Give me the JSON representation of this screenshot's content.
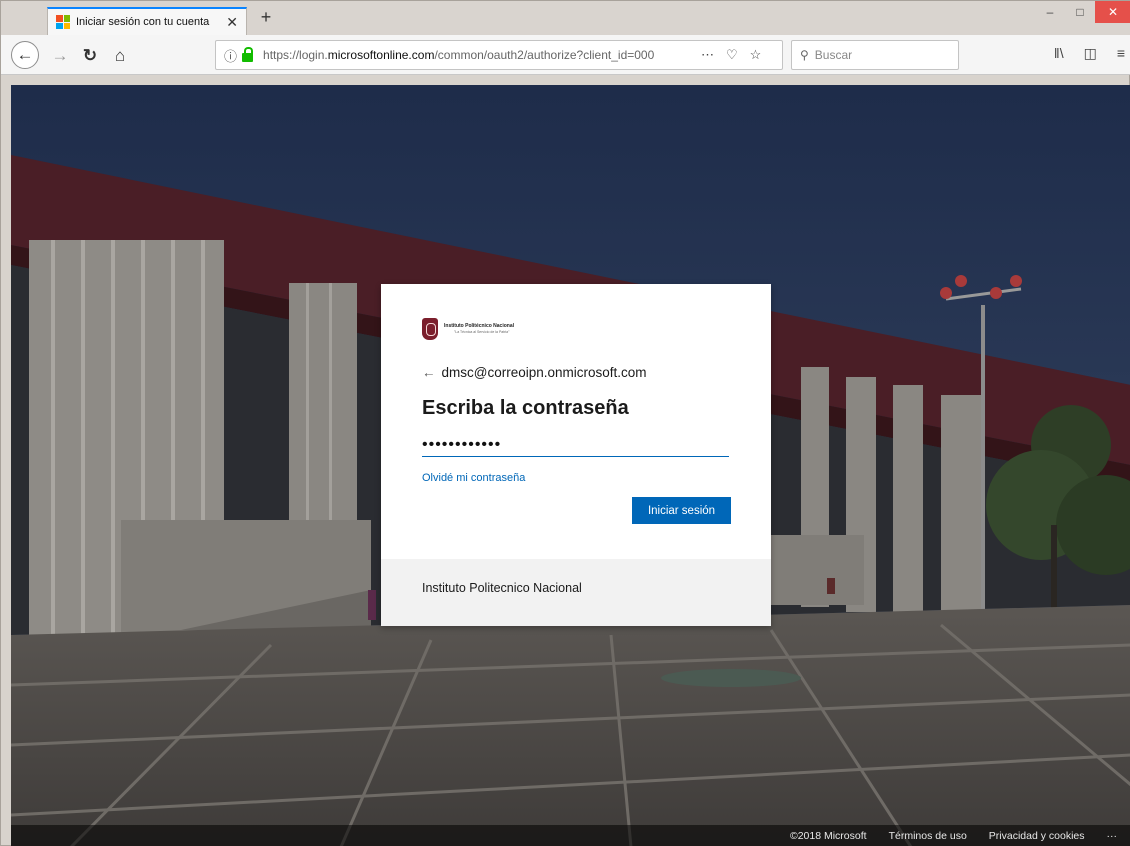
{
  "browser": {
    "tab_title": "Iniciar sesión con tu cuenta",
    "tab_close": "✕",
    "new_tab": "+",
    "url_prefix": "https://login.",
    "url_domain": "microsoftonline.com",
    "url_path": "/common/oauth2/authorize?client_id=000",
    "search_placeholder": "Buscar",
    "win_minimize": "–",
    "win_maximize": "□",
    "win_close": "✕"
  },
  "signin": {
    "account": "dmsc@correoipn.onmicrosoft.com",
    "heading": "Escriba la contraseña",
    "password_value": "••••••••••••",
    "forgot_link": "Olvidé mi contraseña",
    "submit_label": "Iniciar sesión",
    "org_name": "Instituto Politecnico Nacional",
    "logo_name": "Instituto Politécnico Nacional",
    "logo_motto": "\"La Técnica al Servicio de la Patria\""
  },
  "footer": {
    "copyright": "©2018 Microsoft",
    "terms": "Términos de uso",
    "privacy": "Privacidad y cookies",
    "more": "···"
  },
  "colors": {
    "accent": "#0067b8",
    "tab_accent": "#0a84ff",
    "lock_green": "#12bc00",
    "logo_maroon": "#7b1e2c"
  },
  "icons": {
    "favicon": "microsoft-logo-icon",
    "back": "back-arrow-icon",
    "forward": "forward-arrow-icon",
    "reload": "reload-icon",
    "home": "home-icon",
    "info": "info-icon",
    "lock": "lock-icon",
    "more": "ellipsis-icon",
    "pocket": "pocket-icon",
    "bookmark": "star-icon",
    "search": "search-icon",
    "library": "library-icon",
    "sidebar": "sidebar-icon",
    "menu": "hamburger-menu-icon"
  }
}
